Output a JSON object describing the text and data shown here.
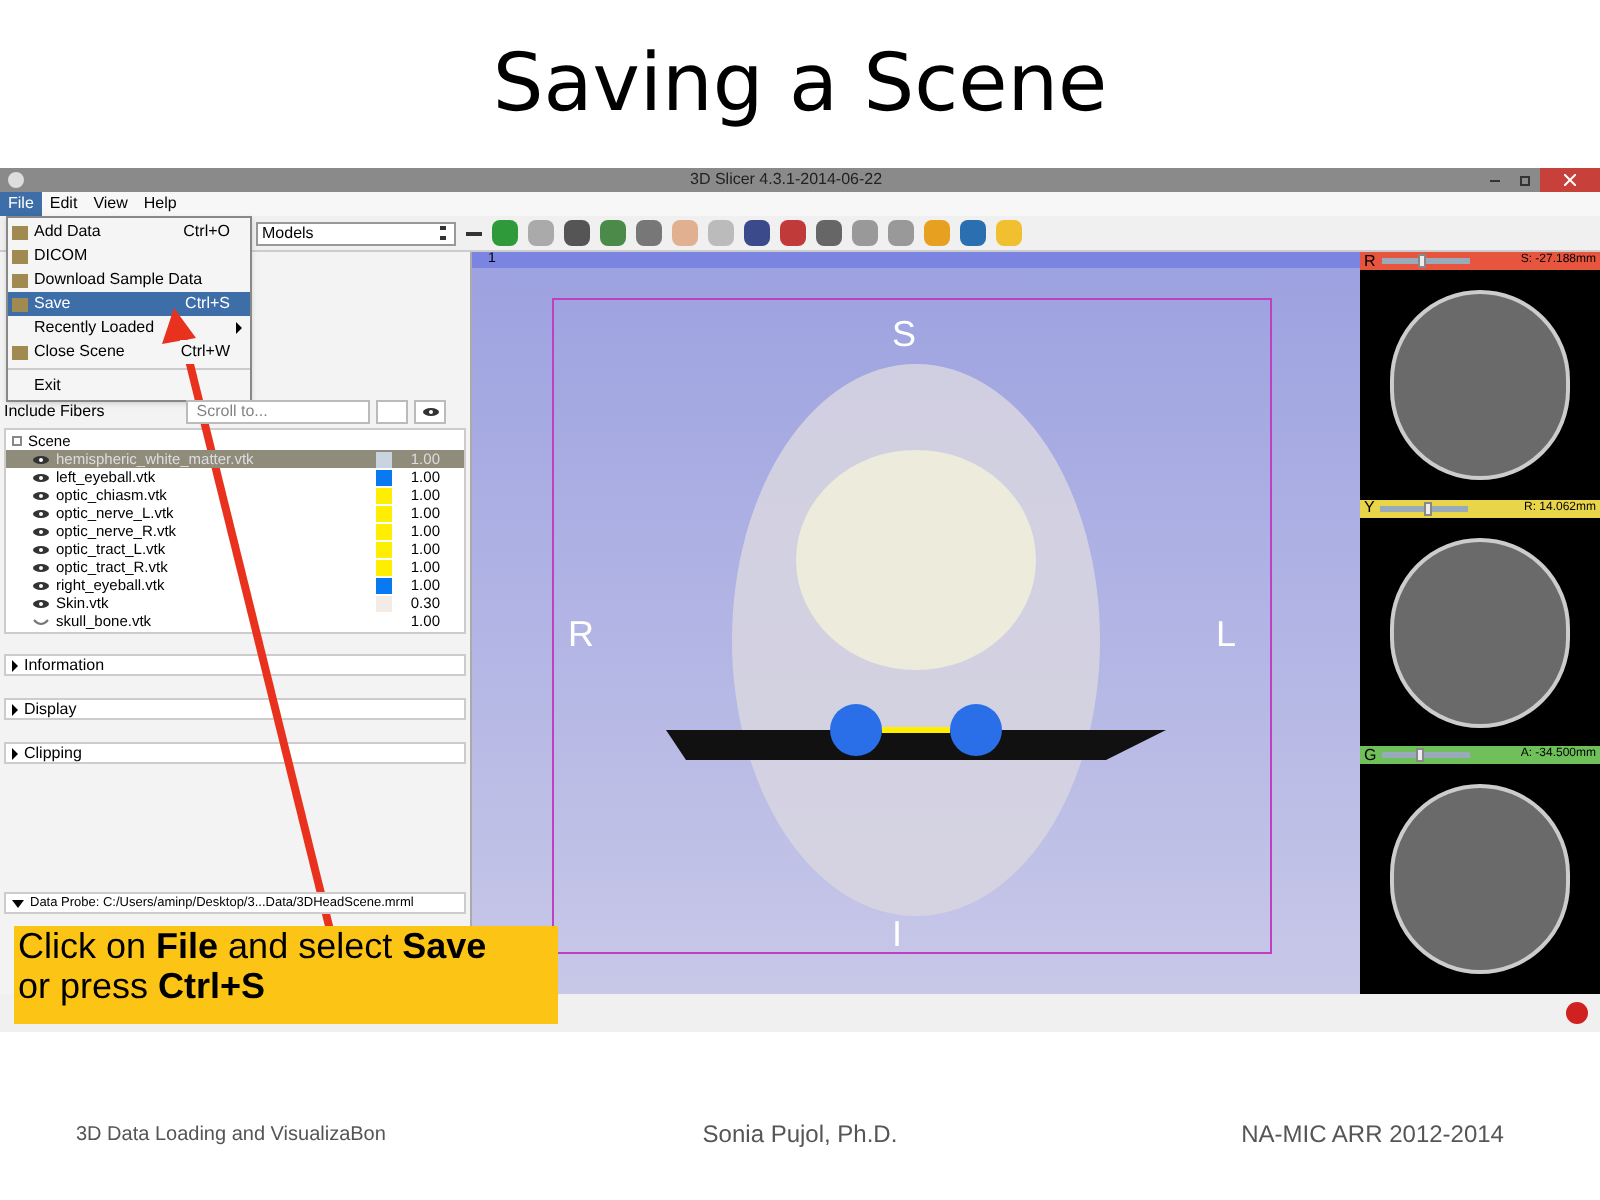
{
  "slide_title": "Saving a Scene",
  "window": {
    "title": "3D Slicer 4.3.1-2014-06-22"
  },
  "menu_bar": [
    {
      "label": "File",
      "selected": true
    },
    {
      "label": "Edit",
      "selected": false
    },
    {
      "label": "View",
      "selected": false
    },
    {
      "label": "Help",
      "selected": false
    }
  ],
  "file_menu": [
    {
      "kind": "item",
      "label": "Add Data",
      "shortcut": "Ctrl+O",
      "selected": false
    },
    {
      "kind": "item",
      "label": "DICOM",
      "selected": false
    },
    {
      "kind": "item",
      "label": "Download Sample Data",
      "selected": false
    },
    {
      "kind": "item",
      "label": "Save",
      "shortcut": "Ctrl+S",
      "selected": true
    },
    {
      "kind": "submenu",
      "label": "Recently Loaded",
      "selected": false
    },
    {
      "kind": "item",
      "label": "Close Scene",
      "shortcut": "Ctrl+W",
      "selected": false
    },
    {
      "kind": "separator"
    },
    {
      "kind": "plain",
      "label": "Exit",
      "selected": false
    }
  ],
  "module_selector": {
    "value": "Models"
  },
  "filter_row": {
    "label": "Include Fibers",
    "search_placeholder": "Scroll to..."
  },
  "scene_tree": {
    "root": "Scene",
    "children": [
      {
        "name": "hemispheric_white_matter.vtk",
        "visible": true,
        "selected": true,
        "color": "#c8d4e0",
        "opacity": "1.00"
      },
      {
        "name": "left_eyeball.vtk",
        "visible": true,
        "selected": false,
        "color": "#0a78f0",
        "opacity": "1.00"
      },
      {
        "name": "optic_chiasm.vtk",
        "visible": true,
        "selected": false,
        "color": "#ffee00",
        "opacity": "1.00"
      },
      {
        "name": "optic_nerve_L.vtk",
        "visible": true,
        "selected": false,
        "color": "#ffee00",
        "opacity": "1.00"
      },
      {
        "name": "optic_nerve_R.vtk",
        "visible": true,
        "selected": false,
        "color": "#ffee00",
        "opacity": "1.00"
      },
      {
        "name": "optic_tract_L.vtk",
        "visible": true,
        "selected": false,
        "color": "#ffee00",
        "opacity": "1.00"
      },
      {
        "name": "optic_tract_R.vtk",
        "visible": true,
        "selected": false,
        "color": "#ffee00",
        "opacity": "1.00"
      },
      {
        "name": "right_eyeball.vtk",
        "visible": true,
        "selected": false,
        "color": "#0a78f0",
        "opacity": "1.00"
      },
      {
        "name": "Skin.vtk",
        "visible": true,
        "selected": false,
        "color": "#f3ece6",
        "opacity": "0.30"
      },
      {
        "name": "skull_bone.vtk",
        "visible": false,
        "selected": false,
        "opacity": "1.00"
      }
    ]
  },
  "sections": [
    {
      "label": "Information",
      "expanded": false
    },
    {
      "label": "Display",
      "expanded": false
    },
    {
      "label": "Clipping",
      "expanded": false
    }
  ],
  "data_probe": {
    "label": "Data Probe: C:/Users/aminp/Desktop/3...Data/3DHeadScene.mrml",
    "expanded": false
  },
  "view_3d": {
    "number": "1",
    "labels": {
      "top": "S",
      "left": "R",
      "right": "L",
      "bottom": "I"
    }
  },
  "slice_views": [
    {
      "letter": "R",
      "color": "#e8553f",
      "level": 0.45,
      "reading": "S: -27.188mm"
    },
    {
      "letter": "Y",
      "color": "#e8d54a",
      "level": 0.55,
      "reading": "R: 14.062mm"
    },
    {
      "letter": "G",
      "color": "#6fc05a",
      "level": 0.42,
      "reading": "A: -34.500mm"
    }
  ],
  "callout": "Click on **File** and select **Save**\nor press **Ctrl+S**",
  "footer": {
    "left": "3D Data Loading and VisualizaBon",
    "center": "Sonia Pujol, Ph.D.",
    "right": "NA-MIC ARR 2012-2014"
  }
}
